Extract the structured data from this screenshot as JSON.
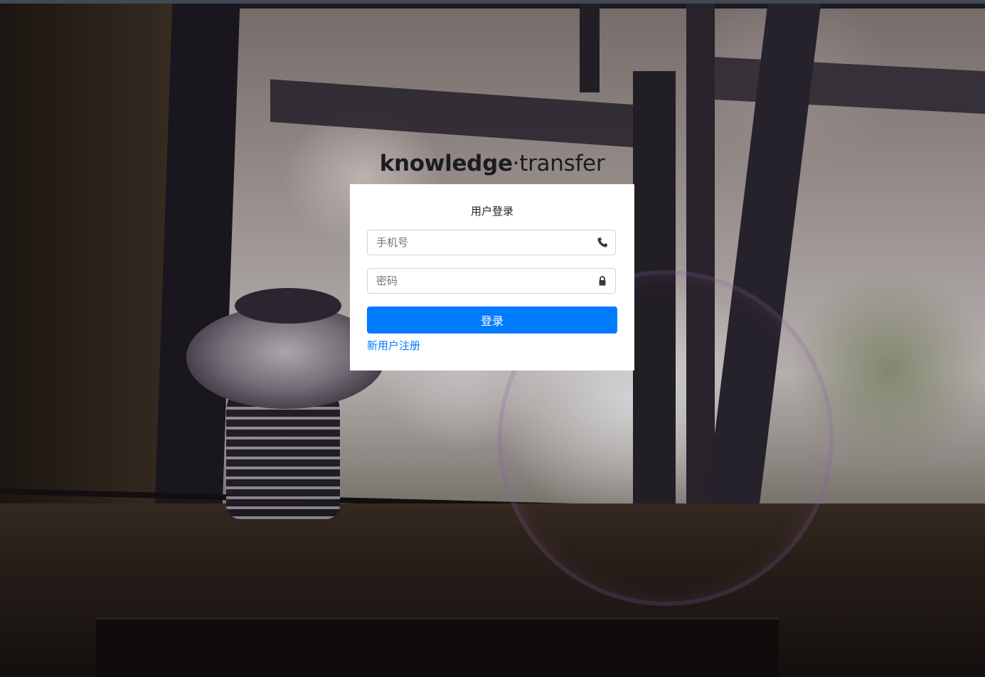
{
  "brand": {
    "part1": "knowledge",
    "separator": "·",
    "part2": "transfer"
  },
  "login": {
    "title": "用户登录",
    "phone_placeholder": "手机号",
    "phone_icon": "phone-icon",
    "password_placeholder": "密码",
    "password_icon": "lock-icon",
    "submit_label": "登录",
    "register_label": "新用户注册"
  },
  "colors": {
    "primary": "#007bff",
    "card_bg": "#ffffff",
    "title_text": "#1a1c20"
  }
}
